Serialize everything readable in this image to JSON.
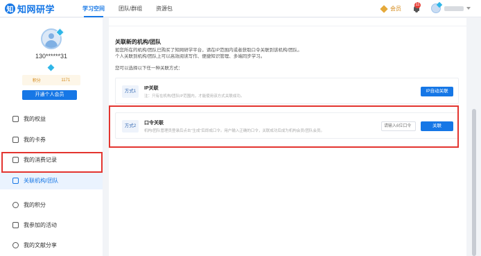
{
  "header": {
    "logo_mark": "知",
    "logo_text": "知网研学",
    "nav": [
      {
        "label": "学习空间",
        "active": true
      },
      {
        "label": "团队/群组",
        "active": false
      },
      {
        "label": "资源包",
        "active": false
      }
    ],
    "vip_label": "会员",
    "notification_count": "11"
  },
  "sidebar": {
    "phone": "130******31",
    "points_label": "积分",
    "points_value": "1171",
    "vip_button": "开通个人会员",
    "menu": [
      {
        "label": "我的权益",
        "icon": "diamond-icon"
      },
      {
        "label": "我的卡券",
        "icon": "coupon-icon"
      },
      {
        "label": "我的消费记录",
        "icon": "record-icon"
      },
      {
        "label": "关联机构/团队",
        "icon": "link-org-icon",
        "active": true
      },
      {
        "label": "我的积分",
        "icon": "coin-icon"
      },
      {
        "label": "我参加的活动",
        "icon": "activity-icon"
      },
      {
        "label": "我的文献分享",
        "icon": "share-icon"
      }
    ]
  },
  "main": {
    "section_title": "关联新的机构/团队",
    "desc_1": "如您所在的机构/团队已购买了知网研学平台，请在IP范围内或者获取口令关联到该机构/团队。",
    "desc_2": "个人关联到机构/团队上可以高效阅读写作、便捷知识管理、多端同步学习。",
    "desc_3": "您可以选择以下任一种关联方式：",
    "method_1": {
      "tag": "方式1",
      "title": "IP关联",
      "desc": "注：只有在机构/团队IP范围内，才能使用该方式关联成功。",
      "button": "IP自动关联"
    },
    "method_2": {
      "tag": "方式2",
      "title": "口令关联",
      "desc": "机构/团队管理员登录后点击\"生成\"后即成口令。用户输入正确的口令，关联成功后成为机构会员/团队会员。",
      "input_placeholder": "请输入6位口令",
      "button": "关联"
    }
  },
  "colors": {
    "accent": "#1677e6",
    "highlight_border": "#e3342f",
    "vip_gold": "#d48a1a"
  }
}
